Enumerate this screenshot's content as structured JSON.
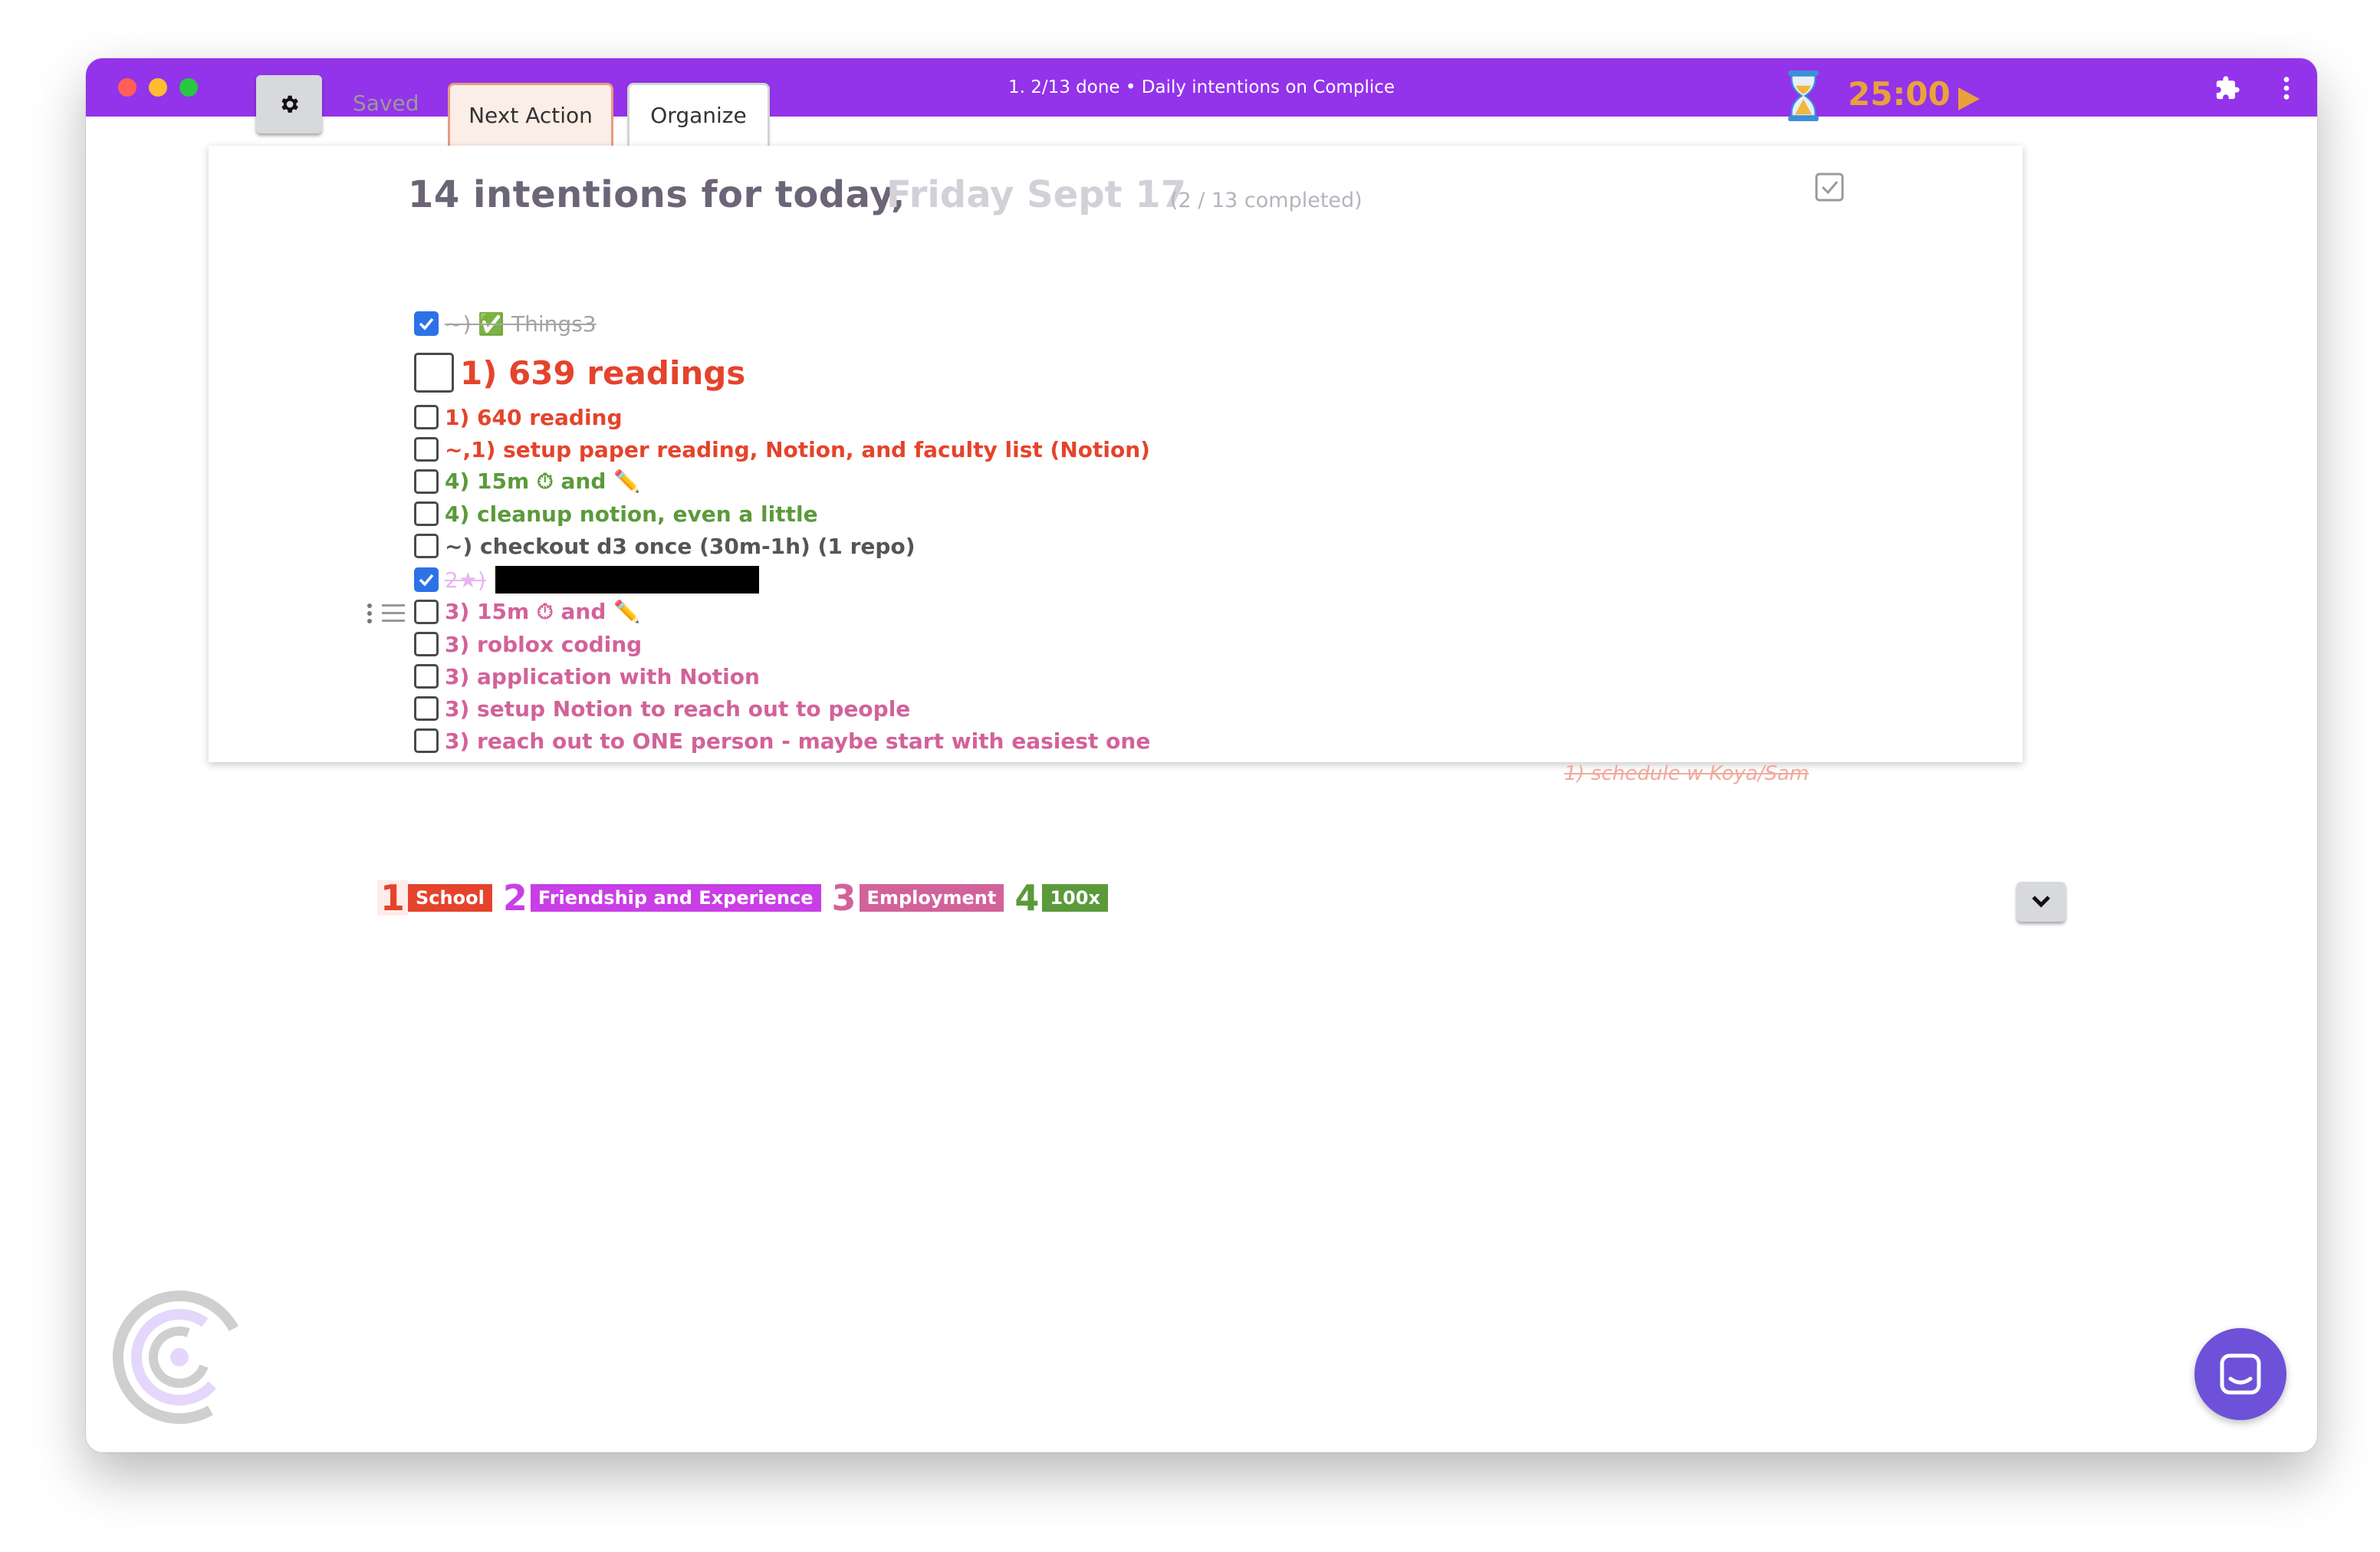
{
  "window": {
    "title": "1. 2/13 done • Daily intentions on Complice"
  },
  "toolbar": {
    "saved_label": "Saved",
    "tabs": [
      {
        "label": "Next Action"
      },
      {
        "label": "Organize"
      }
    ],
    "timer": "25:00"
  },
  "intentions": {
    "heading": "14 intentions for today,",
    "date": "Friday Sept 17",
    "completed": "(2 / 13 completed)",
    "items": [
      {
        "text": "~) ✅ Things3",
        "checked": true,
        "color": "#555555"
      },
      {
        "text": "1) 639 readings",
        "checked": false,
        "color": "#e5432c"
      },
      {
        "text": "1) 640 reading",
        "checked": false,
        "color": "#e5432c"
      },
      {
        "text": "~,1) setup paper reading, Notion, and faculty list (Notion)",
        "checked": false,
        "color": "#e5432c"
      },
      {
        "text": "4) 15m ⏱ and ✏️",
        "checked": false,
        "color": "#5b9a3a"
      },
      {
        "text": "4) cleanup notion, even a little",
        "checked": false,
        "color": "#5b9a3a"
      },
      {
        "text": "~) checkout d3 once (30m-1h) (1 repo)",
        "checked": false,
        "color": "#555555"
      },
      {
        "text": "2★)",
        "checked": true,
        "color": "#c44de0",
        "redacted": true
      },
      {
        "text": "3) 15m ⏱ and ✏️",
        "checked": false,
        "color": "#d2629a"
      },
      {
        "text": "3) roblox coding",
        "checked": false,
        "color": "#d2629a"
      },
      {
        "text": "3) application with Notion",
        "checked": false,
        "color": "#d2629a"
      },
      {
        "text": "3) setup Notion to reach out to people",
        "checked": false,
        "color": "#d2629a"
      },
      {
        "text": "3) reach out to ONE person - maybe start with easiest one",
        "checked": false,
        "color": "#d2629a"
      }
    ],
    "side_note": "1) schedule w Koya/Sam"
  },
  "goals": [
    {
      "num": "1",
      "label": "School",
      "color": "#e5432c"
    },
    {
      "num": "2",
      "label": "Friendship and Experience",
      "color": "#c93ee6"
    },
    {
      "num": "3",
      "label": "Employment",
      "color": "#d2629a"
    },
    {
      "num": "4",
      "label": "100x",
      "color": "#5b9a3a"
    }
  ],
  "icons": {
    "settings": "gear-icon",
    "extensions": "puzzle-icon",
    "menu": "kebab-icon",
    "timer": "hourglass-icon",
    "play": "play-icon",
    "collapse": "chevron-down-icon",
    "chat": "chat-icon",
    "logo": "complice-logo-icon"
  }
}
